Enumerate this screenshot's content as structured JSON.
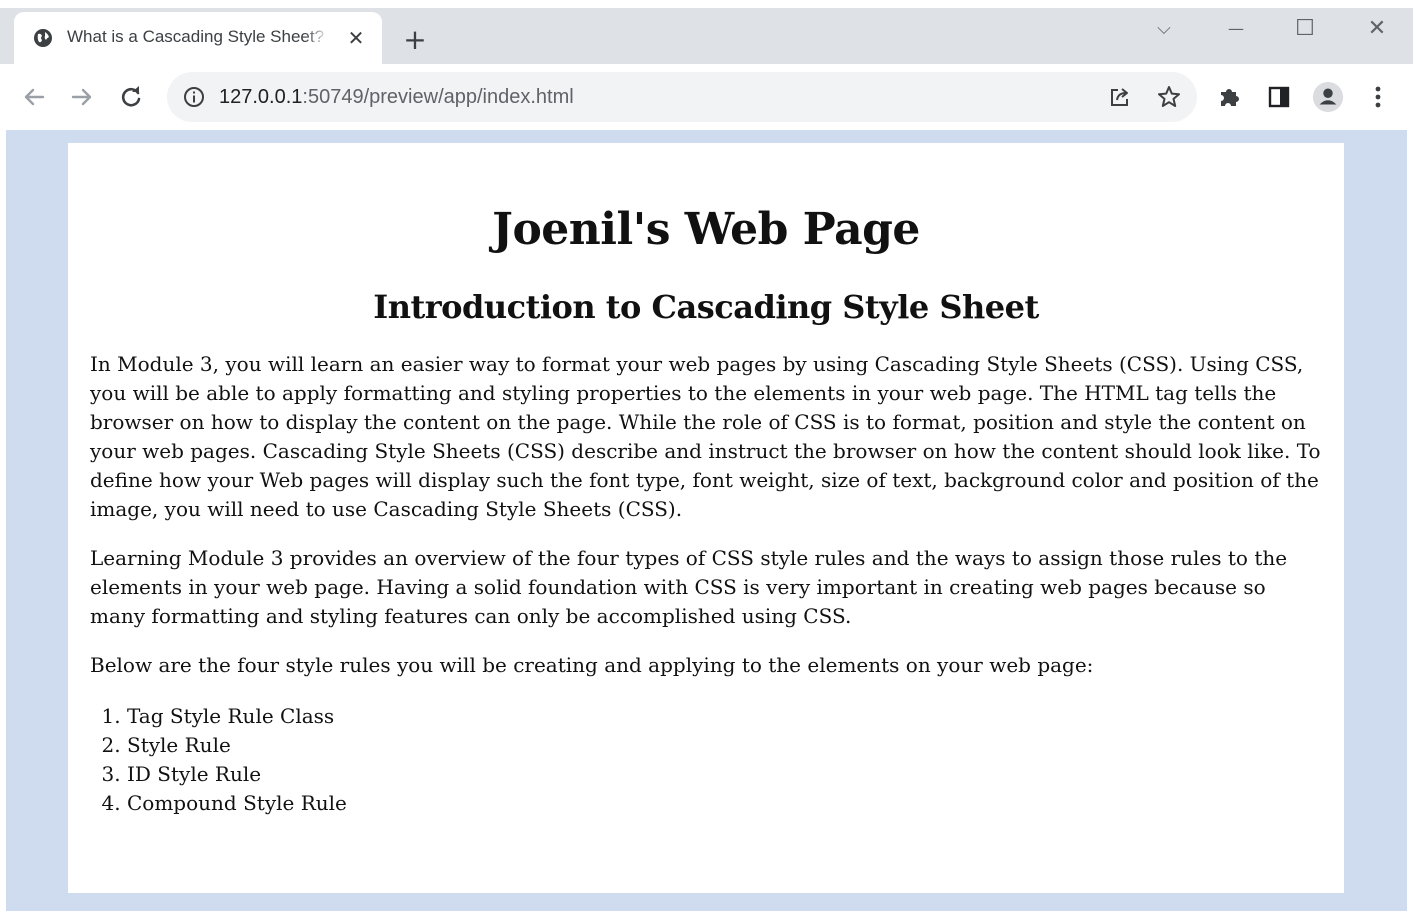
{
  "browser": {
    "tab": {
      "title": "What is a Cascading Style Sheet?",
      "close_glyph": "✕"
    },
    "new_tab_glyph": "+",
    "window_controls": {
      "dropdown": "⌵",
      "minimize": "—",
      "maximize": "☐",
      "close": "✕"
    },
    "address_bar": {
      "host": "127.0.0.1",
      "rest": ":50749/preview/app/index.html"
    },
    "icons": [
      "back-arrow-icon",
      "forward-arrow-icon",
      "reload-icon",
      "site-info-icon",
      "share-icon",
      "bookmark-star-icon",
      "extensions-puzzle-icon",
      "side-panel-icon",
      "profile-avatar-icon",
      "kebab-menu-icon"
    ],
    "colors": {
      "tabstrip": "#dee1e6",
      "omnibox": "#f1f3f4",
      "page_background": "#cfdcf0"
    }
  },
  "page": {
    "title": "Joenil's Web Page",
    "subtitle": "Introduction to Cascading Style Sheet",
    "paragraphs": [
      "In Module 3, you will learn an easier way to format your web pages by using Cascading Style Sheets (CSS). Using CSS, you will be able to apply formatting and styling properties to the elements in your web page. The HTML tag tells the browser on how to display the content on the page. While the role of CSS is to format, position and style the content on your web pages. Cascading Style Sheets (CSS) describe and instruct the browser on how the content should look like. To define how your Web pages will display such the font type, font weight, size of text, background color and position of the image, you will need to use Cascading Style Sheets (CSS).",
      "Learning Module 3 provides an overview of the four types of CSS style rules and the ways to assign those rules to the elements in your web page. Having a solid foundation with CSS is very important in creating web pages because so many formatting and styling features can only be accomplished using CSS.",
      "Below are the four style rules you will be creating and applying to the elements on your web page:"
    ],
    "list": [
      "Tag Style Rule Class",
      "Style Rule",
      "ID Style Rule",
      "Compound Style Rule"
    ]
  }
}
